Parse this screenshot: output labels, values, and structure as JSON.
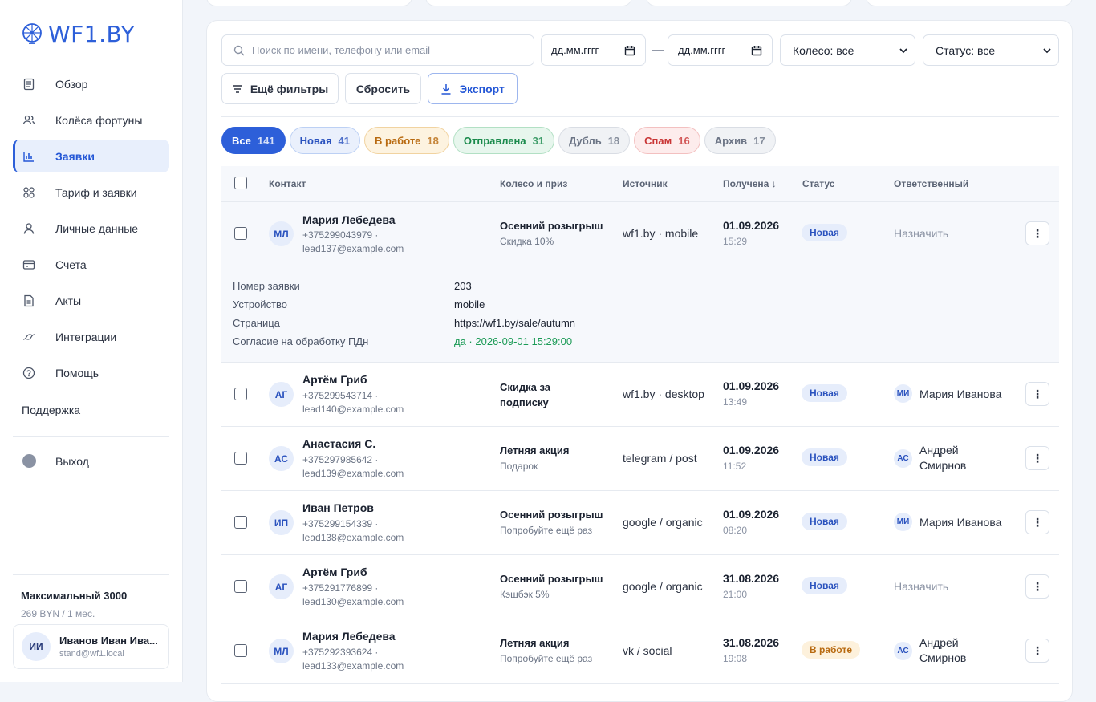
{
  "brand": {
    "name": "WF1.BY"
  },
  "sidebar": {
    "items": [
      {
        "label": "Обзор",
        "icon": "document-icon"
      },
      {
        "label": "Колёса фортуны",
        "icon": "users-icon"
      },
      {
        "label": "Заявки",
        "icon": "bar-chart-icon",
        "active": true
      },
      {
        "label": "Тариф и заявки",
        "icon": "grid-icon"
      },
      {
        "label": "Личные данные",
        "icon": "user-icon"
      },
      {
        "label": "Счета",
        "icon": "card-icon"
      },
      {
        "label": "Акты",
        "icon": "file-icon"
      },
      {
        "label": "Интеграции",
        "icon": "plug-icon"
      },
      {
        "label": "Помощь",
        "icon": "help-icon"
      }
    ],
    "support": "Поддержка",
    "logout": "Выход",
    "plan": {
      "name": "Максимальный 3000",
      "price": "269 BYN / 1 мес."
    },
    "user": {
      "initials": "ИИ",
      "name": "Иванов Иван Ива...",
      "email": "stand@wf1.local"
    }
  },
  "filters": {
    "search_placeholder": "Поиск по имени, телефону или email",
    "date_from": "дд.мм.гггг",
    "date_to": "дд.мм.гггг",
    "dash": "—",
    "wheel": "Колесо: все",
    "status": "Статус: все",
    "more_filters": "Ещё фильтры",
    "reset": "Сбросить",
    "export": "Экспорт"
  },
  "tabs": [
    {
      "label": "Все",
      "count": "141"
    },
    {
      "label": "Новая",
      "count": "41"
    },
    {
      "label": "В работе",
      "count": "18"
    },
    {
      "label": "Отправлена",
      "count": "31"
    },
    {
      "label": "Дубль",
      "count": "18"
    },
    {
      "label": "Спам",
      "count": "16"
    },
    {
      "label": "Архив",
      "count": "17"
    }
  ],
  "table": {
    "headers": {
      "contact": "Контакт",
      "wheel": "Колесо и приз",
      "source": "Источник",
      "received": "Получена ↓",
      "status": "Статус",
      "responsible": "Ответственный"
    },
    "rows": [
      {
        "initials": "МЛ",
        "name": "Мария Лебедева",
        "phone": "+375299043979 ·",
        "email": "lead137@example.com",
        "wheel": "Осенний розыгрыш",
        "prize": "Скидка 10%",
        "source": "wf1.by · mobile",
        "date": "01.09.2026",
        "time": "15:29",
        "status": "Новая",
        "resp_initials": "",
        "resp_name": "",
        "assign": "Назначить"
      },
      {
        "initials": "АГ",
        "name": "Артём Гриб",
        "phone": "+375299543714 ·",
        "email": "lead140@example.com",
        "wheel": "Скидка за подписку",
        "prize": "",
        "source": "wf1.by · desktop",
        "date": "01.09.2026",
        "time": "13:49",
        "status": "Новая",
        "resp_initials": "МИ",
        "resp_name": "Мария Иванова",
        "assign": ""
      },
      {
        "initials": "АС",
        "name": "Анастасия С.",
        "phone": "+375297985642 ·",
        "email": "lead139@example.com",
        "wheel": "Летняя акция",
        "prize": "Подарок",
        "source": "telegram / post",
        "date": "01.09.2026",
        "time": "11:52",
        "status": "Новая",
        "resp_initials": "АС",
        "resp_name": "Андрей Смирнов",
        "assign": ""
      },
      {
        "initials": "ИП",
        "name": "Иван Петров",
        "phone": "+375299154339 ·",
        "email": "lead138@example.com",
        "wheel": "Осенний розыгрыш",
        "prize": "Попробуйте ещё раз",
        "source": "google / organic",
        "date": "01.09.2026",
        "time": "08:20",
        "status": "Новая",
        "resp_initials": "МИ",
        "resp_name": "Мария Иванова",
        "assign": ""
      },
      {
        "initials": "АГ",
        "name": "Артём Гриб",
        "phone": "+375291776899 ·",
        "email": "lead130@example.com",
        "wheel": "Осенний розыгрыш",
        "prize": "Кэшбэк 5%",
        "source": "google / organic",
        "date": "31.08.2026",
        "time": "21:00",
        "status": "Новая",
        "resp_initials": "",
        "resp_name": "",
        "assign": "Назначить"
      },
      {
        "initials": "МЛ",
        "name": "Мария Лебедева",
        "phone": "+375292393624 ·",
        "email": "lead133@example.com",
        "wheel": "Летняя акция",
        "prize": "Попробуйте ещё раз",
        "source": "vk / social",
        "date": "31.08.2026",
        "time": "19:08",
        "status": "В работе",
        "resp_initials": "АС",
        "resp_name": "Андрей Смирнов",
        "assign": ""
      }
    ]
  },
  "details": {
    "order_label": "Номер заявки",
    "order_value": "203",
    "device_label": "Устройство",
    "device_value": "mobile",
    "page_label": "Страница",
    "page_value": "https://wf1.by/sale/autumn",
    "consent_label": "Согласие на обработку ПДн",
    "consent_value": "да · 2026-09-01 15:29:00"
  },
  "colors": {
    "accent": "#2d5fd9",
    "accent_bg": "#e8effc"
  }
}
